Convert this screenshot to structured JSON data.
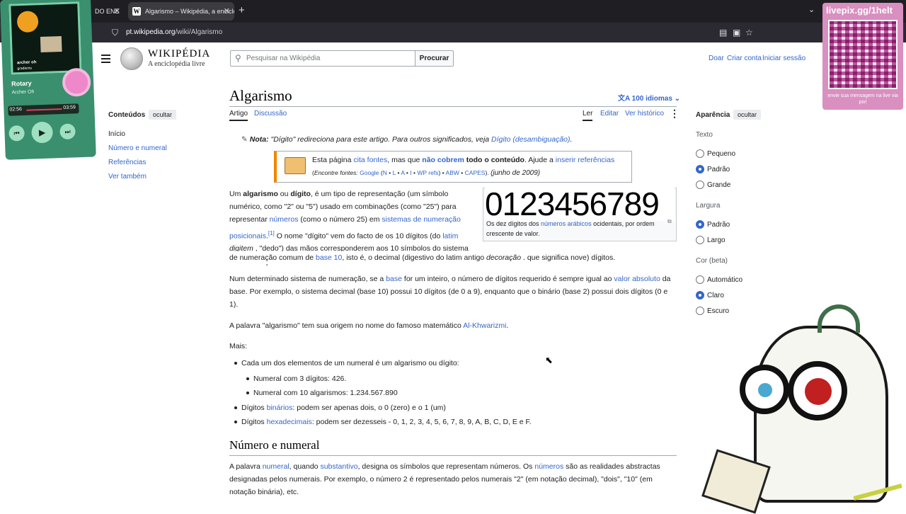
{
  "browser": {
    "tabs": [
      {
        "label": "DO ENE"
      },
      {
        "label": "Algarismo – Wikipédia, a enciclo"
      }
    ],
    "url_domain": "pt.wikipedia.org",
    "url_path": "/wiki/Algarismo"
  },
  "header": {
    "wordmark": "WIKIPÉDIA",
    "tagline": "A enciclopédia livre",
    "search_placeholder": "Pesquisar na Wikipédia",
    "search_button": "Procurar",
    "user_links": [
      "Doar",
      "Criar conta",
      "Iniciar sessão"
    ]
  },
  "page": {
    "title": "Algarismo",
    "languages": "100 idiomas",
    "tabs_left": [
      "Artigo",
      "Discussão"
    ],
    "tabs_right": [
      "Ler",
      "Editar",
      "Ver histórico"
    ]
  },
  "toc": {
    "title": "Conteúdos",
    "hide": "ocultar",
    "items": [
      "Início",
      "Número e numeral",
      "Referências",
      "Ver também"
    ]
  },
  "appearance": {
    "title": "Aparência",
    "hide": "ocultar",
    "text_label": "Texto",
    "text_options": [
      "Pequeno",
      "Padrão",
      "Grande"
    ],
    "width_label": "Largura",
    "width_options": [
      "Padrão",
      "Largo"
    ],
    "color_label": "Cor (beta)",
    "color_options": [
      "Automático",
      "Claro",
      "Escuro"
    ]
  },
  "hatnote": {
    "bold": "Nota:",
    "text": " \"Dígito\" redireciona para este artigo. Para outros significados, veja ",
    "link": "Dígito (desambiguação)",
    "end": "."
  },
  "ambox": {
    "t1": "Esta página ",
    "l1": "cita fontes",
    "t2": ", mas que ",
    "b1": "não cobrem",
    "t3": " todo o conteúdo",
    "t4": ". Ajude a ",
    "l2": "inserir referências",
    "l3a": "(",
    "l3b": "Encontre fontes:",
    "l3c": "Google",
    "l3d": "(",
    "l3e": "N",
    "l3f": "•",
    "l3g": "L",
    "l3h": "•",
    "l3i": "A",
    "l3j": "•",
    "l3k": "I",
    "l3l": "•",
    "l3m": "WP refs",
    "l3n": ") ",
    "l3o": "•",
    "l3p": "ABW",
    "l3q": "•",
    "l3r": "CAPES",
    "l3s": ").",
    "date": "(junho de 2009)"
  },
  "figure": {
    "digits": "0123456789",
    "cap1": "Os dez dígitos dos ",
    "cap_link": "números arábicos",
    "cap2": " ocidentais, por ordem crescente de valor."
  },
  "para1": {
    "a": "Um ",
    "b": "algarismo",
    "c": " ou ",
    "d": "dígito",
    "e": ", é um tipo de representação (um símbolo numérico, como \"2\" ou \"5\") usado em combinações (como \"25\") para representar ",
    "f": "números",
    "g": " (como o número 25) em ",
    "h": "sistemas de numeração posicionais",
    "i": ".",
    "ref": "[1]",
    "j": " O nome \"dígito\" vem do facto de os 10 dígitos (do ",
    "k": "latim",
    "l": " ",
    "m": "digitem",
    "n": " , \"dedo\") das mãos corresponderem aos 10 símbolos do sistema de numeração comum de ",
    "o": "base 10",
    "p": ", isto é, o decimal (digestivo do latim antigo ",
    "q": "decoração",
    "r": " . que significa nove) dígitos."
  },
  "para2": {
    "a": "Num determinado sistema de numeração, se a ",
    "b": "base",
    "c": " for um inteiro, o número de dígitos requerido é sempre igual ao ",
    "d": "valor absoluto",
    "e": " da base. Por exemplo, o sistema decimal (base 10) possui 10 dígitos (de 0 a 9), enquanto que o binário (base 2) possui dois dígitos (0 e 1)."
  },
  "para3": {
    "a": "A palavra \"algarismo\" tem sua origem no nome do famoso matemático ",
    "b": "Al-Khwarizmi",
    "c": "."
  },
  "para4": "Mais:",
  "list": {
    "i1": "Cada um dos elementos de um numeral é um algarismo ou dígito:",
    "i1a": "Numeral com 3 dígitos: 426.",
    "i1b": "Numeral com 10 algarismos: 1.234.567.890",
    "i2a": "Dígitos ",
    "i2b": "binários",
    "i2c": ": podem ser apenas dois, o 0 (zero) e o 1 (um)",
    "i3a": "Dígitos ",
    "i3b": "hexadecimais",
    "i3c": ": podem ser dezesseis - 0, 1, 2, 3, 4, 5, 6, 7, 8, 9, A, B, C, D, E e F."
  },
  "section2": {
    "title": "Número e numeral",
    "a": "A palavra ",
    "b": "numeral",
    "c": ", quando ",
    "d": "substantivo",
    "e": ", designa os símbolos que representam números. Os ",
    "f": "números",
    "g": " são as realidades abstractas designadas pelos numerais. Por exemplo, o número 2 é representado pelos numerais \"2\" (em notação decimal), \"dois\", \"10\" (em notação binária), etc."
  },
  "overlay_player": {
    "title": "Rotary",
    "artist": "Archer Oh",
    "time_now": "02:56",
    "time_total": "03:59",
    "album_small": "archer oh",
    "album_small2": "gradients"
  },
  "overlay_qr": {
    "handle": "livepix.gg/1helt",
    "caption": "envie sua mensagem na live via pix!"
  },
  "colors": {
    "link": "#3366cc",
    "player_bg": "#3a8f6e",
    "qr_bg": "#d98fc0"
  }
}
